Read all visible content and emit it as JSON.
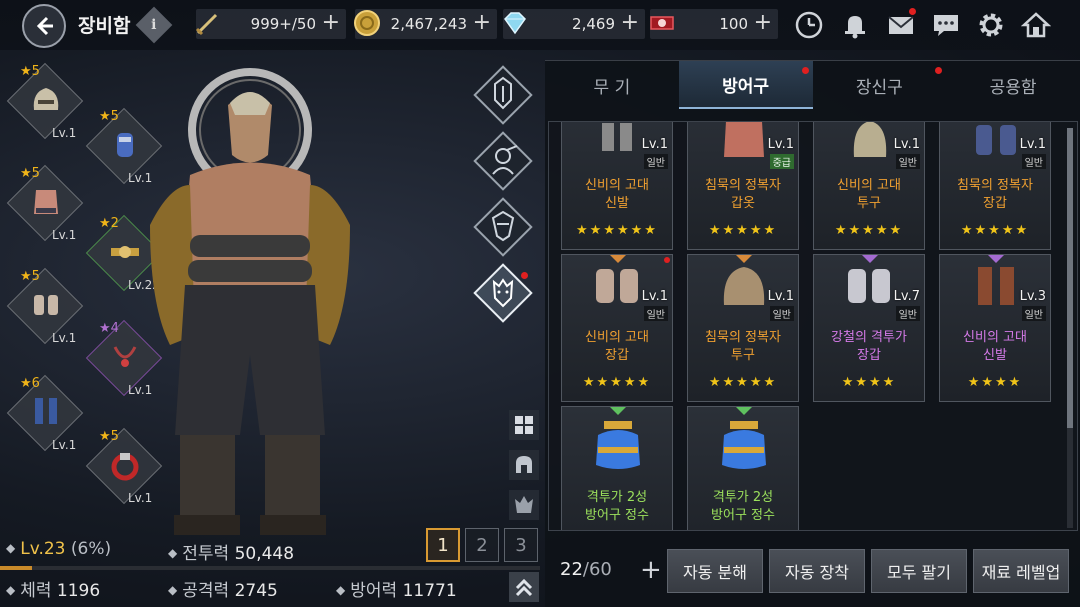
{
  "header": {
    "title": "장비함",
    "info_label": "i"
  },
  "resources": [
    {
      "name": "stamina",
      "icon": "sword-icon",
      "value": "999+/50"
    },
    {
      "name": "gold",
      "icon": "gold-coin-icon",
      "value": "2,467,243"
    },
    {
      "name": "diamond",
      "icon": "diamond-icon",
      "value": "2,469"
    },
    {
      "name": "ticket",
      "icon": "ruby-ticket-icon",
      "value": "100"
    }
  ],
  "plus_symbol": "+",
  "top_icons": [
    "clock-icon",
    "bell-icon",
    "mail-icon",
    "chat-icon",
    "settings-icon",
    "home-icon"
  ],
  "equipment_slots": [
    {
      "stars": "★5",
      "level": "Lv.1",
      "item": "helmet"
    },
    {
      "stars": "★5",
      "level": "Lv.1",
      "item": "gauntlet"
    },
    {
      "stars": "★5",
      "level": "Lv.1",
      "item": "armor"
    },
    {
      "stars": "★2",
      "level": "Lv.22",
      "item": "belt"
    },
    {
      "stars": "★5",
      "level": "Lv.1",
      "item": "gloves"
    },
    {
      "stars": "★4",
      "level": "Lv.1",
      "item": "necklace"
    },
    {
      "stars": "★6",
      "level": "Lv.1",
      "item": "boots"
    },
    {
      "stars": "★5",
      "level": "Lv.1",
      "item": "ring"
    }
  ],
  "category_icons": [
    "knight-class-icon",
    "female-warrior-icon",
    "assassin-class-icon",
    "fighter-class-icon"
  ],
  "view_icons": [
    "grid-view-icon",
    "helmet-filter-icon",
    "crest-filter-icon"
  ],
  "pages": [
    "1",
    "2",
    "3"
  ],
  "stats": {
    "level": "Lv.23",
    "level_pct": "(6%)",
    "xp_fraction": 0.06,
    "combat_power_label": "전투력",
    "combat_power": "50,448",
    "hp_label": "체력",
    "hp": "1196",
    "atk_label": "공격력",
    "atk": "2745",
    "def_label": "방어력",
    "def": "11771"
  },
  "tabs": [
    {
      "label": "무 기",
      "active": false,
      "dot": false
    },
    {
      "label": "방어구",
      "active": true,
      "dot": true
    },
    {
      "label": "장신구",
      "active": false,
      "dot": true
    },
    {
      "label": "공용함",
      "active": false,
      "dot": false
    }
  ],
  "cards": [
    {
      "level": "Lv.1",
      "grade": "일반",
      "name1": "신비의 고대",
      "name2": "신발",
      "stars": "★★★★★★",
      "color": "orange"
    },
    {
      "level": "Lv.1",
      "grade": "중급",
      "name1": "침묵의 정복자",
      "name2": "갑옷",
      "stars": "★★★★★",
      "color": "orange"
    },
    {
      "level": "Lv.1",
      "grade": "일반",
      "name1": "신비의 고대",
      "name2": "투구",
      "stars": "★★★★★",
      "color": "orange"
    },
    {
      "level": "Lv.1",
      "grade": "일반",
      "name1": "침묵의 정복자",
      "name2": "장갑",
      "stars": "★★★★★",
      "color": "orange"
    },
    {
      "level": "Lv.1",
      "grade": "일반",
      "name1": "신비의 고대",
      "name2": "장갑",
      "stars": "★★★★★",
      "color": "orange"
    },
    {
      "level": "Lv.1",
      "grade": "일반",
      "name1": "침묵의 정복자",
      "name2": "투구",
      "stars": "★★★★★",
      "color": "orange"
    },
    {
      "level": "Lv.7",
      "grade": "일반",
      "name1": "강철의 격투가",
      "name2": "장갑",
      "stars": "★★★★",
      "color": "purple"
    },
    {
      "level": "Lv.3",
      "grade": "일반",
      "name1": "신비의 고대",
      "name2": "신발",
      "stars": "★★★★",
      "color": "purple"
    },
    {
      "level": "",
      "grade": "",
      "name1": "격투가 2성",
      "name2": "방어구 정수",
      "stars": "",
      "color": "green"
    },
    {
      "level": "",
      "grade": "",
      "name1": "격투가 2성",
      "name2": "방어구 정수",
      "stars": "",
      "color": "green"
    }
  ],
  "inventory": {
    "count": "22",
    "max": "/60",
    "plus": "+"
  },
  "actions": [
    "자동 분해",
    "자동 장착",
    "모두 팔기",
    "재료 레벨업"
  ],
  "colors": {
    "accent_gold": "#f0c419",
    "orange_name": "#f0a030",
    "purple_name": "#d57ae8",
    "green_name": "#9be05c"
  }
}
